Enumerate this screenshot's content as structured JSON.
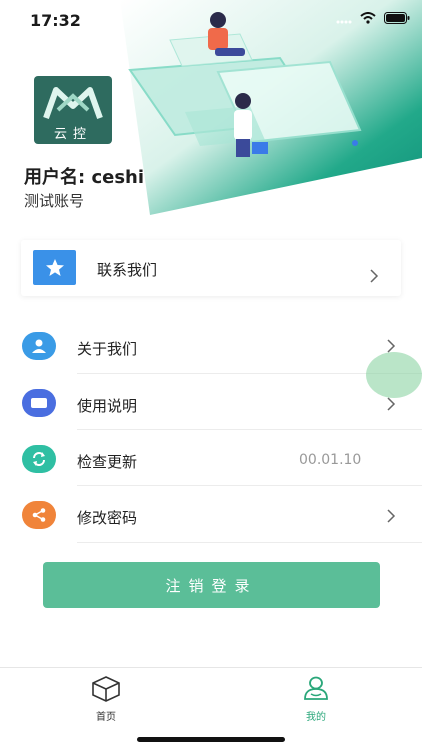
{
  "status_bar": {
    "time": "17:32"
  },
  "profile": {
    "logo_text": "云控",
    "username_line": "用户名: ceshi",
    "account_type": "测试账号"
  },
  "contact": {
    "label": "联系我们"
  },
  "menu": {
    "items": [
      {
        "label": "关于我们",
        "icon": "user-icon",
        "color": "#3a9be6"
      },
      {
        "label": "使用说明",
        "icon": "message-icon",
        "color": "#4a6ee0"
      },
      {
        "label": "检查更新",
        "icon": "refresh-icon",
        "color": "#2fbfa3",
        "value": "00.01.10"
      },
      {
        "label": "修改密码",
        "icon": "share-icon",
        "color": "#f0843a"
      }
    ]
  },
  "logout": {
    "label": "注销登录"
  },
  "tabbar": {
    "items": [
      {
        "label": "首页",
        "icon": "cube-icon",
        "color": "#333333"
      },
      {
        "label": "我的",
        "icon": "profile-icon",
        "color": "#2aa77a"
      }
    ]
  },
  "colors": {
    "accent": "#5bbe98",
    "header_green": "#1fa884"
  }
}
